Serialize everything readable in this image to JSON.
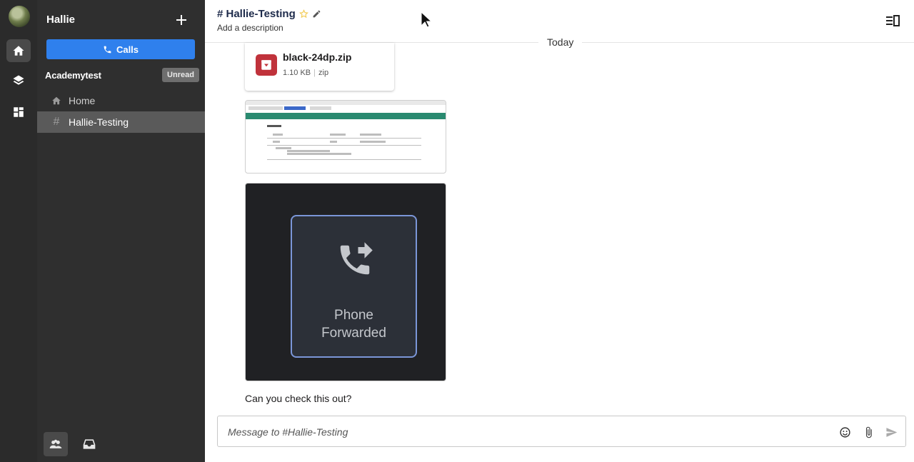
{
  "user": {
    "name": "Hallie"
  },
  "sidebar": {
    "calls_label": "Calls",
    "team_name": "Academytest",
    "unread_label": "Unread",
    "items": [
      {
        "label": "Home",
        "icon": "home-icon"
      },
      {
        "label": "Hallie-Testing",
        "icon": "hash-icon"
      }
    ]
  },
  "header": {
    "title": "# Hallie-Testing",
    "description": "Add a description"
  },
  "content": {
    "date_label": "Today",
    "file": {
      "name": "black-24dp.zip",
      "size": "1.10 KB",
      "ext": "zip"
    },
    "media_text_line1": "Phone",
    "media_text_line2": "Forwarded",
    "message": "Can you check this out?"
  },
  "composer": {
    "placeholder": "Message to #Hallie-Testing"
  },
  "colors": {
    "accent": "#2f80ed",
    "sidebar": "#2f2f2f",
    "rail": "#2b2b2b",
    "file_icon": "#c0323b",
    "star": "#f2c94c"
  }
}
